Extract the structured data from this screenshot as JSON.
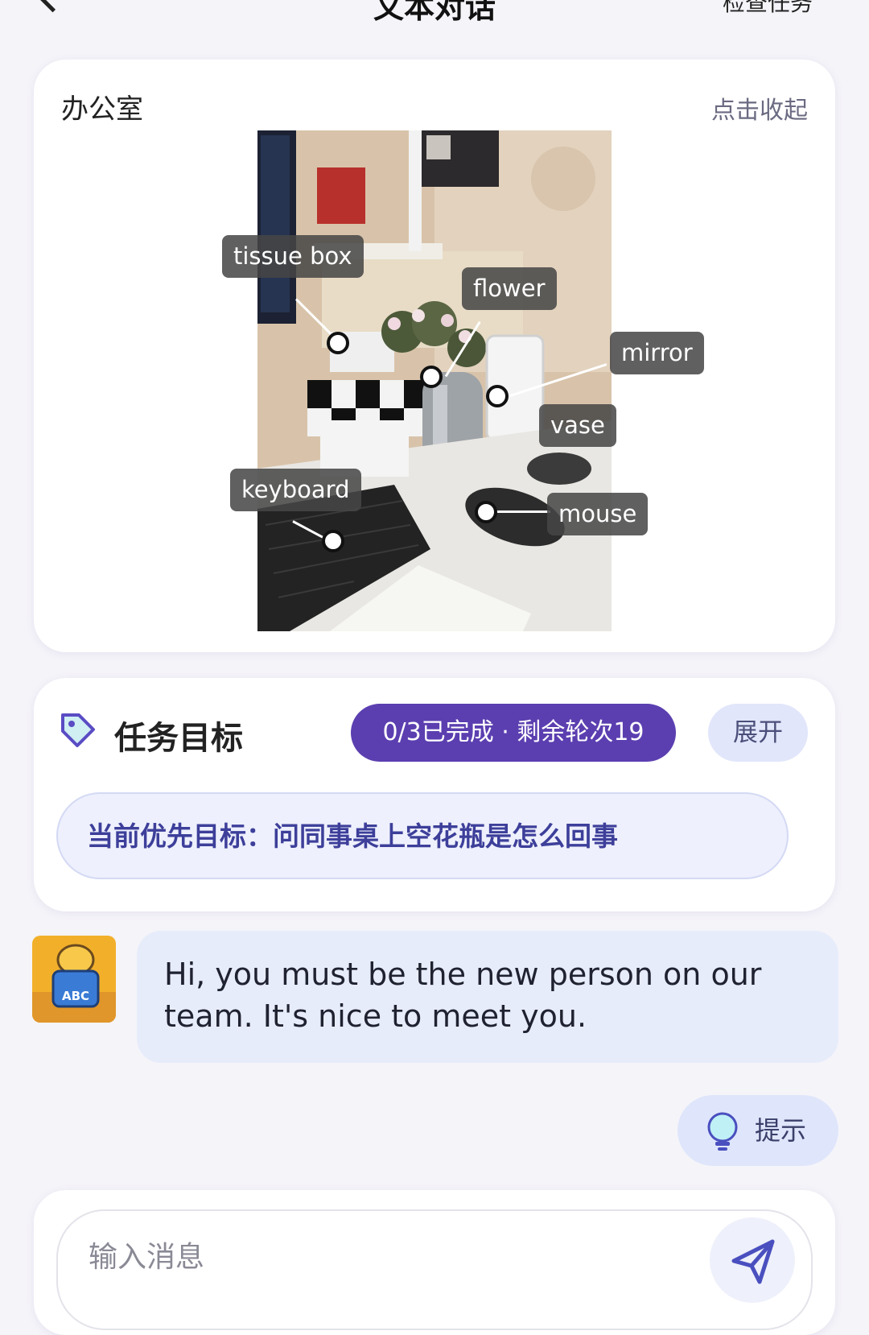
{
  "header": {
    "title": "文本对话",
    "right_label": "检查任务"
  },
  "scene": {
    "title": "办公室",
    "collapse_label": "点击收起",
    "tags": {
      "tissue_box": "tissue box",
      "flower": "flower",
      "mirror": "mirror",
      "vase": "vase",
      "keyboard": "keyboard",
      "mouse": "mouse"
    }
  },
  "task": {
    "title": "任务目标",
    "progress_label": "0/3已完成 · 剩余轮次19",
    "expand_label": "展开",
    "priority_text": "当前优先目标：问同事桌上空花瓶是怎么回事"
  },
  "chat": {
    "avatar_text": "ABC",
    "message": "Hi, you must be the new person on our team. It's nice to meet you."
  },
  "hint": {
    "label": "提示"
  },
  "composer": {
    "placeholder": "输入消息"
  },
  "colors": {
    "accent": "#5b3fb0",
    "chip": "#e1e6fb",
    "bubble": "#e7ecfb",
    "priority_text": "#3d3f9a"
  },
  "icons": [
    "back-chevron-icon",
    "tag-icon",
    "lightbulb-icon",
    "send-icon"
  ]
}
